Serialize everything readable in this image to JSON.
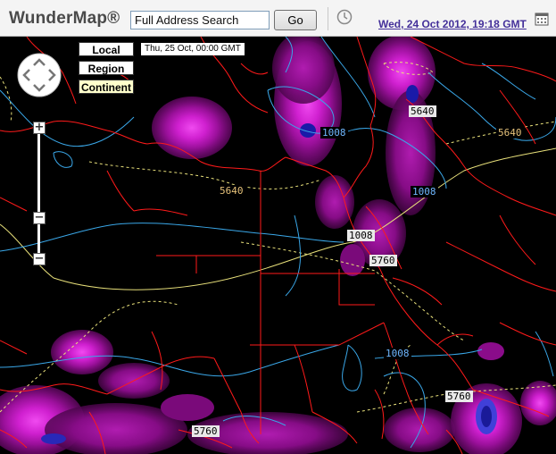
{
  "app": {
    "title": "WunderMap®"
  },
  "toolbar": {
    "search_placeholder": "Full Address Search",
    "go_label": "Go",
    "date_link": "Wed, 24 Oct 2012, 19:18 GMT",
    "icons": {
      "clock": "clock-icon",
      "calendar": "calendar-icon"
    }
  },
  "scope": {
    "local": "Local",
    "region": "Region",
    "continent": "Continent",
    "selected": "Continent"
  },
  "forecast_time": "Thu, 25 Oct, 00:00 GMT",
  "nav": {
    "zoom_in": "+",
    "zoom_out": "−",
    "zoom_mid": "−"
  },
  "contour_labels": {
    "blue": [
      "1008",
      "1008",
      "1008",
      "1008"
    ],
    "gold": [
      "5640",
      "5640"
    ],
    "highlight": [
      "5640",
      "5760",
      "5760",
      "5760"
    ]
  },
  "colors": {
    "background": "#000000",
    "borders": "#ff1a1a",
    "isobars": "#3aa7e8",
    "thickness": "#e8e07a",
    "precip_light": "#7a0a7a",
    "precip_mid": "#b018b0",
    "precip_heavy": "#e833e8",
    "precip_core": "#1a1aa8"
  }
}
